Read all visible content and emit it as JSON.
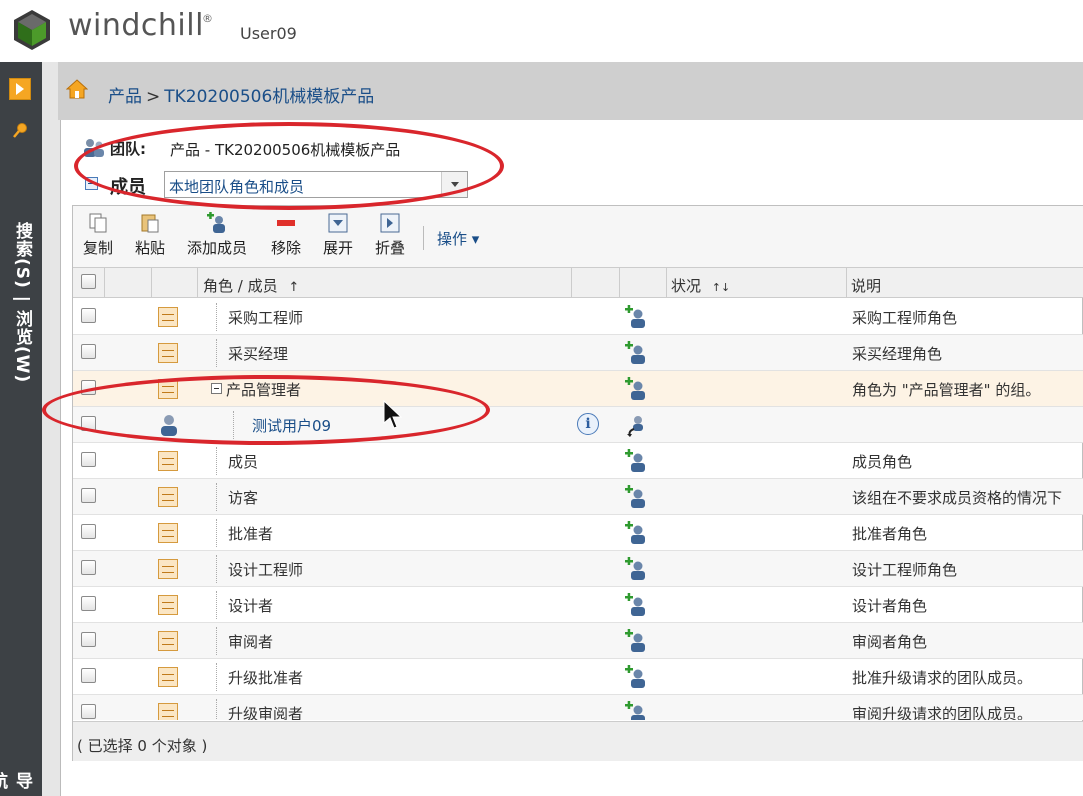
{
  "app": {
    "brand": "windchill",
    "brand_mark": "®",
    "user": "User09"
  },
  "left_rail": {
    "search_browse": "搜索(S) | 浏览(W)",
    "navigator": "导航器"
  },
  "breadcrumb": {
    "root": "产品",
    "separator": ">",
    "current": "TK20200506机械模板产品"
  },
  "team": {
    "label": "团队:",
    "value": "产品 - TK20200506机械模板产品"
  },
  "members": {
    "label": "成员",
    "selected": "本地团队角色和成员"
  },
  "toolbar": {
    "copy": "复制",
    "paste": "粘贴",
    "add_member": "添加成员",
    "remove": "移除",
    "expand": "展开",
    "collapse": "折叠",
    "actions": "操作 ▾"
  },
  "columns": {
    "role_member": "角色 / 成员",
    "role_sort": "↑",
    "status": "状况",
    "status_sort": "↑↓",
    "description": "说明"
  },
  "rows": [
    {
      "name": "采购工程师",
      "description": "采购工程师角色"
    },
    {
      "name": "采买经理",
      "description": "采买经理角色"
    },
    {
      "name": "产品管理者",
      "description": "角色为 \"产品管理者\" 的组。"
    },
    {
      "name": "测试用户09",
      "description": ""
    },
    {
      "name": "成员",
      "description": "成员角色"
    },
    {
      "name": "访客",
      "description": "该组在不要求成员资格的情况下"
    },
    {
      "name": "批准者",
      "description": "批准者角色"
    },
    {
      "name": "设计工程师",
      "description": "设计工程师角色"
    },
    {
      "name": "设计者",
      "description": "设计者角色"
    },
    {
      "name": "审阅者",
      "description": "审阅者角色"
    },
    {
      "name": "升级批准者",
      "description": "批准升级请求的团队成员。"
    },
    {
      "name": "升级审阅者",
      "description": "审阅升级请求的团队成员。"
    }
  ],
  "footer": {
    "selection": "( 已选择 0 个对象 )"
  },
  "colors": {
    "accent": "#1a4e88",
    "annotation": "#d9262c",
    "rail": "#3d4145",
    "selected_row": "#fdf3e5"
  },
  "icons": {
    "logo": "windchill-logo-icon",
    "home": "home-icon",
    "team": "team-icon",
    "role": "role-scroll-icon",
    "user": "user-icon",
    "add_status": "add-user-icon",
    "info": "info-icon",
    "cursor": "mouse-cursor-icon"
  }
}
